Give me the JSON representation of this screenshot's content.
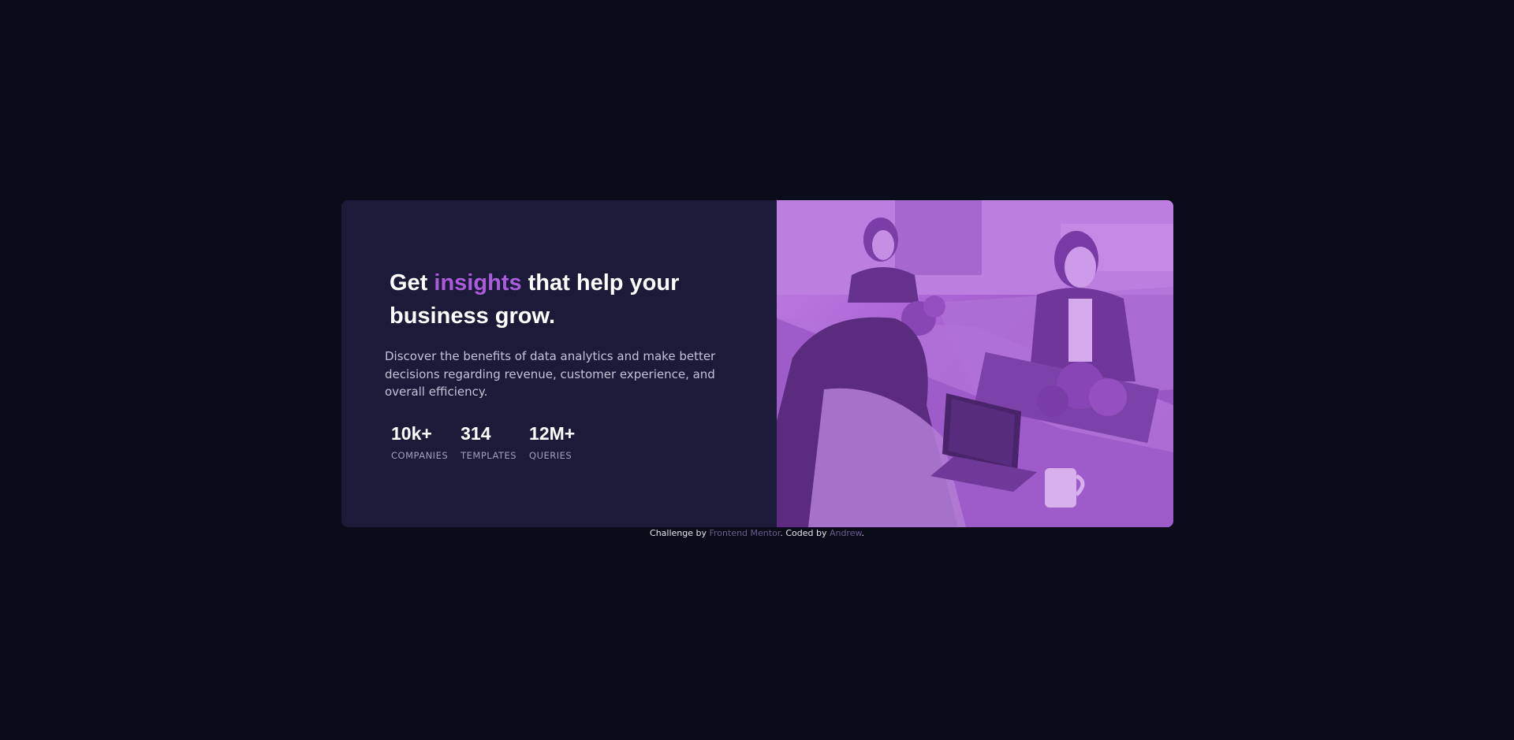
{
  "hero": {
    "headline_pre": "Get ",
    "headline_accent": "insights",
    "headline_post": " that help your business grow.",
    "description": "Discover the benefits of data analytics and make better decisions regarding revenue, customer experience, and overall efficiency."
  },
  "stats": [
    {
      "value": "10k+",
      "label": "COMPANIES"
    },
    {
      "value": "314",
      "label": "TEMPLATES"
    },
    {
      "value": "12M+",
      "label": "QUERIES"
    }
  ],
  "attribution": {
    "prefix": "Challenge by ",
    "link1": "Frontend Mentor",
    "middle": ". Coded by ",
    "link2": "Andrew",
    "suffix": "."
  },
  "colors": {
    "page_bg": "#0a0c1a",
    "card_bg": "#1c1a39",
    "accent": "#aa5cdb",
    "image_tint": "#aa5cdb"
  }
}
